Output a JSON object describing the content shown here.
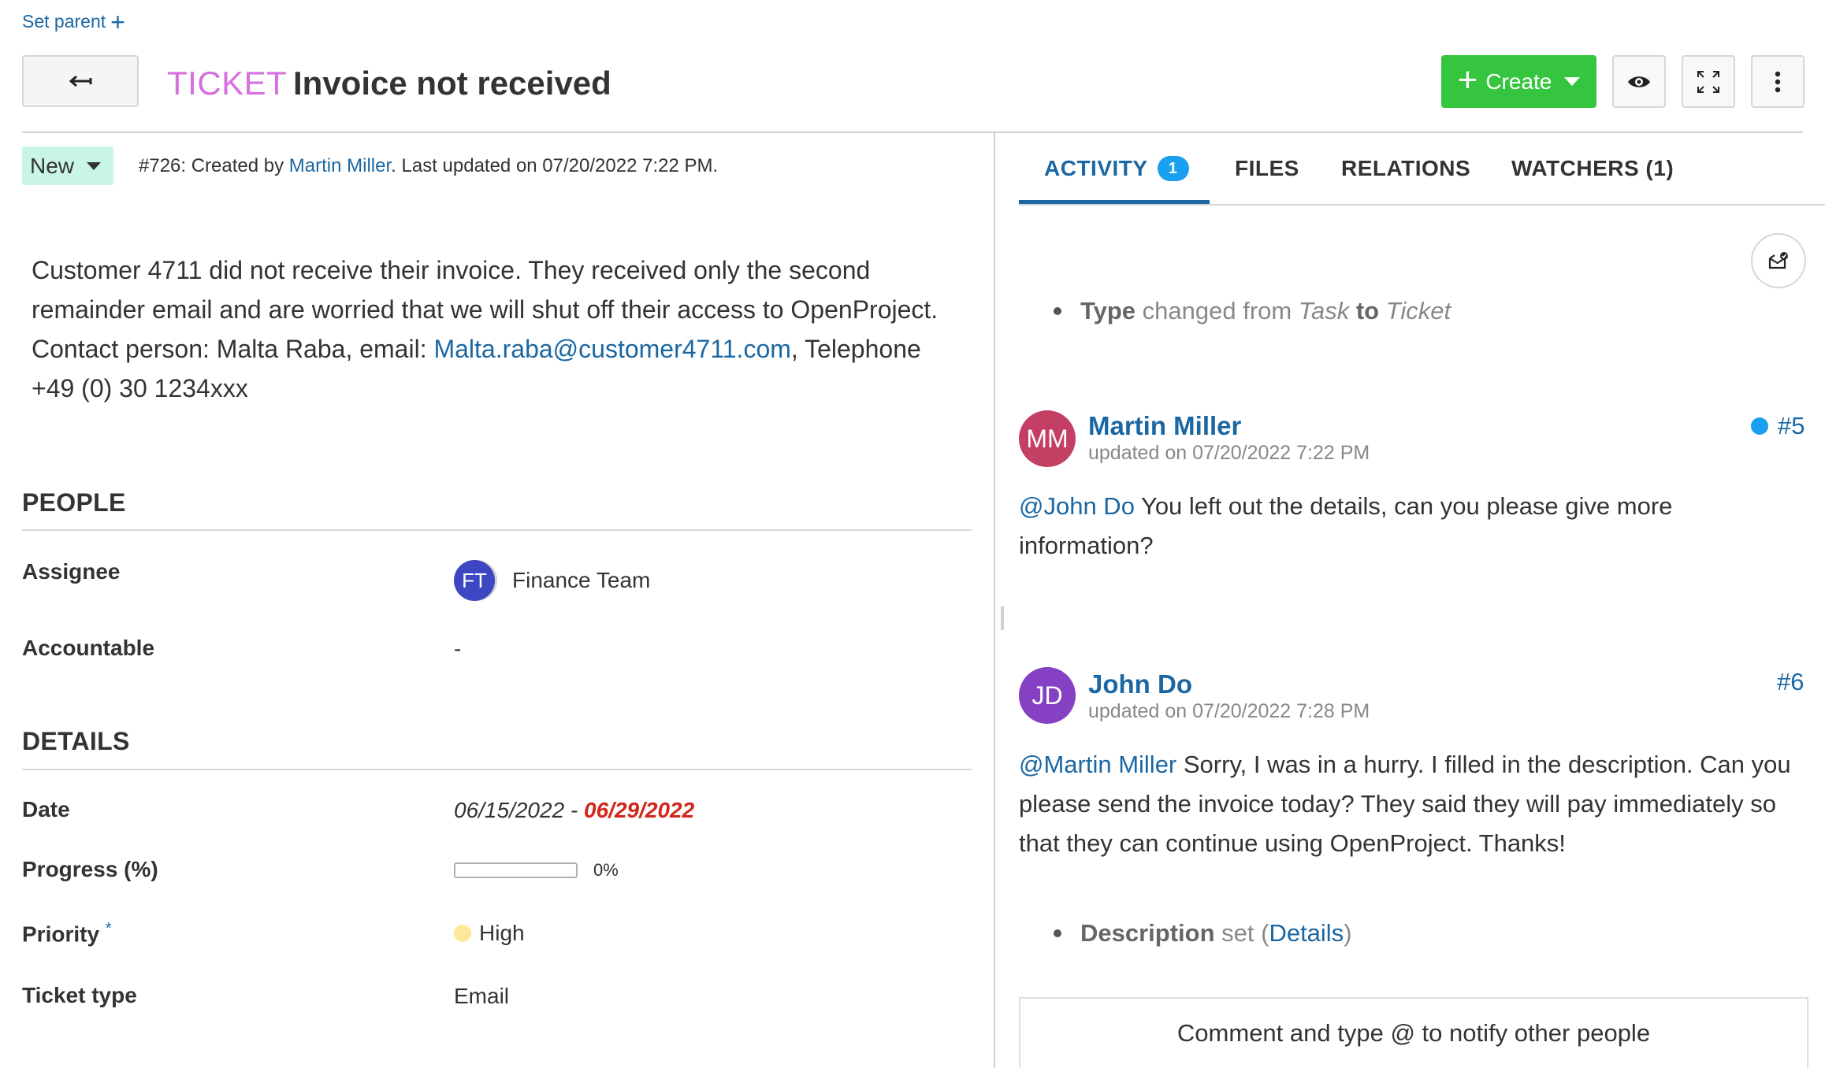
{
  "header": {
    "set_parent": "Set parent",
    "type": "TICKET",
    "subject": "Invoice not received",
    "create_label": "Create",
    "colors": {
      "type": "#d66fe0",
      "create": "#35c53f",
      "link": "#1a67a3"
    },
    "icons": {
      "back": "arrow-left-icon",
      "watch": "eye-icon",
      "fullscreen": "expand-icon",
      "more": "more-vertical-icon"
    }
  },
  "status": {
    "label": "New",
    "color": "#c9f5e6"
  },
  "meta": {
    "prefix": "#726: Created by ",
    "author": "Martin Miller",
    "suffix": ". Last updated on 07/20/2022 7:22 PM."
  },
  "description": {
    "text1": "Customer 4711 did not receive their invoice. They received only the second remainder email and are worried that we will shut off their access to OpenProject. Contact person: Malta Raba, email: ",
    "email": "Malta.raba@customer4711.com",
    "text2": ", Telephone +49 (0) 30 1234xxx"
  },
  "people": {
    "title": "PEOPLE",
    "assignee_label": "Assignee",
    "assignee_initials": "FT",
    "assignee_name": "Finance Team",
    "accountable_label": "Accountable",
    "accountable_value": "-"
  },
  "details": {
    "title": "DETAILS",
    "date_label": "Date",
    "start_date": "06/15/2022",
    "date_sep": " - ",
    "due_date": "06/29/2022",
    "due_color": "#d2261b",
    "progress_label": "Progress (%)",
    "progress_value": "0%",
    "progress_fraction": 0,
    "priority_label": "Priority",
    "required_mark": "*",
    "priority_value": "High",
    "priority_color": "#fde89a",
    "ticket_type_label": "Ticket type",
    "ticket_type_value": "Email"
  },
  "tabs": {
    "activity": "ACTIVITY",
    "activity_count": "1",
    "files": "FILES",
    "relations": "RELATIONS",
    "watchers": "WATCHERS (1)"
  },
  "activity": {
    "change1": {
      "field": "Type",
      "mid": " changed from ",
      "from": "Task",
      "to_word": " to ",
      "to": "Ticket"
    },
    "entry1": {
      "initials": "MM",
      "name": "Martin Miller",
      "date": "updated on 07/20/2022 7:22 PM",
      "number": "#5",
      "mention": "@John Do",
      "text": " You left out the details, can you please give more information?"
    },
    "entry2": {
      "initials": "JD",
      "name": "John Do",
      "date": "updated on 07/20/2022 7:28 PM",
      "number": "#6",
      "mention": "@Martin Miller",
      "text": " Sorry, I was in a hurry. I filled in the description. Can you please send the invoice today? They said they will pay immediately so that they can continue using OpenProject. Thanks!"
    },
    "change2": {
      "field": "Description",
      "mid": " set (",
      "link": "Details",
      "end": ")"
    },
    "comment_placeholder": "Comment and type @ to notify other people"
  }
}
